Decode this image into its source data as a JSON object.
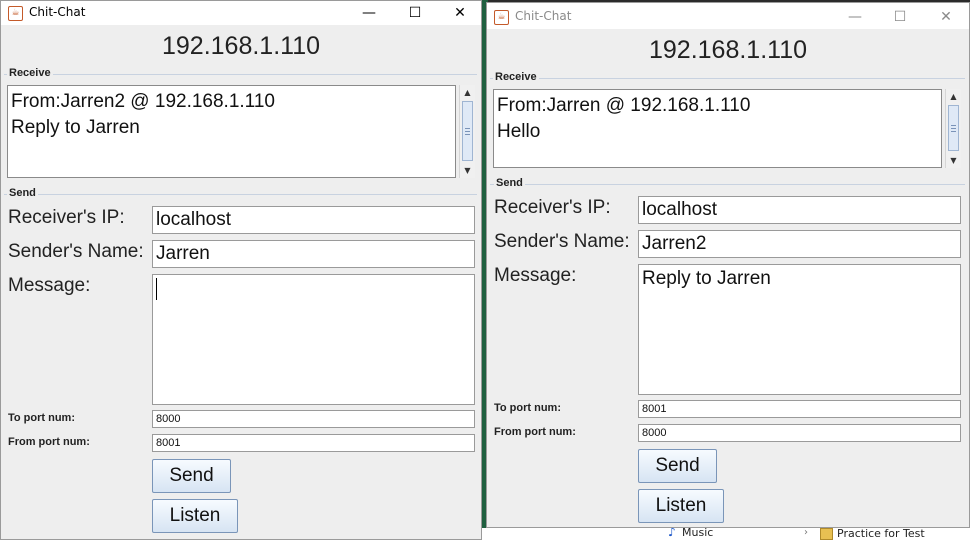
{
  "background": {
    "music_label": "Music",
    "practice_label": "Practice for Test"
  },
  "windows": [
    {
      "title": "Chit-Chat",
      "state": "active",
      "ip_address": "192.168.1.110",
      "receive_label": "Receive",
      "receive_lines": [
        "From:Jarren2 @ 192.168.1.110",
        "Reply to Jarren"
      ],
      "send_label": "Send",
      "receiver_ip_label": "Receiver's IP:",
      "receiver_ip_value": "localhost",
      "sender_name_label": "Sender's Name:",
      "sender_name_value": "Jarren",
      "message_label": "Message:",
      "message_value": "",
      "to_port_label": "To port num:",
      "to_port_value": "8000",
      "from_port_label": "From port num:",
      "from_port_value": "8001",
      "send_button": "Send",
      "listen_button": "Listen"
    },
    {
      "title": "Chit-Chat",
      "state": "inactive",
      "ip_address": "192.168.1.110",
      "receive_label": "Receive",
      "receive_lines": [
        "From:Jarren @ 192.168.1.110",
        "Hello"
      ],
      "send_label": "Send",
      "receiver_ip_label": "Receiver's IP:",
      "receiver_ip_value": "localhost",
      "sender_name_label": "Sender's Name:",
      "sender_name_value": "Jarren2",
      "message_label": "Message:",
      "message_value": "Reply to Jarren",
      "to_port_label": "To port num:",
      "to_port_value": "8001",
      "from_port_label": "From port num:",
      "from_port_value": "8000",
      "send_button": "Send",
      "listen_button": "Listen"
    }
  ],
  "icons": {
    "app": "java-coffee-cup-icon",
    "minimize": "minimize-icon",
    "maximize": "maximize-icon",
    "close": "close-icon",
    "scroll_up": "scroll-up-arrow-icon",
    "scroll_down": "scroll-down-arrow-icon"
  },
  "colors": {
    "window_bg": "#eeeeee",
    "titlebar_bg": "#ffffff",
    "button_border": "#7a95b8",
    "group_line": "#c8d2e0"
  }
}
